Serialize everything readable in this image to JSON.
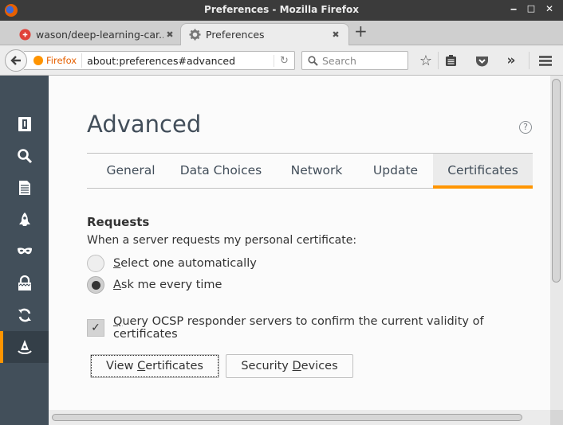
{
  "window": {
    "title": "Preferences - Mozilla Firefox",
    "controls": {
      "minimize": "‒",
      "maximize": "□",
      "close": "✕"
    }
  },
  "tabs": [
    {
      "label": "wason/deep-learning-car...",
      "icon": "github-like-favicon",
      "active": false
    },
    {
      "label": "Preferences",
      "icon": "gear-icon",
      "active": true
    }
  ],
  "tab_close_glyph": "✖",
  "new_tab_glyph": "+",
  "navbar": {
    "back_glyph": "🡐",
    "identity_label": "Firefox",
    "url": "about:preferences#advanced",
    "reload_glyph": "↻",
    "search_placeholder": "Search",
    "search_glyph": "⚲",
    "bookmark_glyph": "☆",
    "overflow_glyph": "»",
    "menu_glyph": "≡"
  },
  "sidebar": {
    "items": [
      {
        "name": "general",
        "icon": "switch-icon"
      },
      {
        "name": "search",
        "icon": "search-icon"
      },
      {
        "name": "content",
        "icon": "document-icon"
      },
      {
        "name": "applications",
        "icon": "rocket-icon"
      },
      {
        "name": "privacy",
        "icon": "mask-icon"
      },
      {
        "name": "security",
        "icon": "lock-icon"
      },
      {
        "name": "sync",
        "icon": "sync-icon"
      },
      {
        "name": "advanced",
        "icon": "wizard-hat-icon",
        "selected": true
      }
    ],
    "accent": "#ff9500"
  },
  "page": {
    "title": "Advanced",
    "help_glyph": "?",
    "tabs": [
      {
        "label": "General",
        "selected": false
      },
      {
        "label": "Data Choices",
        "selected": false
      },
      {
        "label": "Network",
        "selected": false
      },
      {
        "label": "Update",
        "selected": false
      },
      {
        "label": "Certificates",
        "selected": true
      }
    ],
    "requests": {
      "heading": "Requests",
      "description": "When a server requests my personal certificate:",
      "options": [
        {
          "access_key": "S",
          "rest": "elect one automatically",
          "selected": false
        },
        {
          "access_key": "A",
          "rest": "sk me every time",
          "selected": true
        }
      ]
    },
    "ocsp": {
      "access_key": "Q",
      "rest": "uery OCSP responder servers to confirm the current validity of certificates",
      "checked": true,
      "check_glyph": "✓"
    },
    "buttons": {
      "view_certificates": {
        "pre": "View ",
        "key": "C",
        "post": "ertificates"
      },
      "security_devices": {
        "pre": "Security ",
        "key": "D",
        "post": "evices"
      }
    }
  }
}
